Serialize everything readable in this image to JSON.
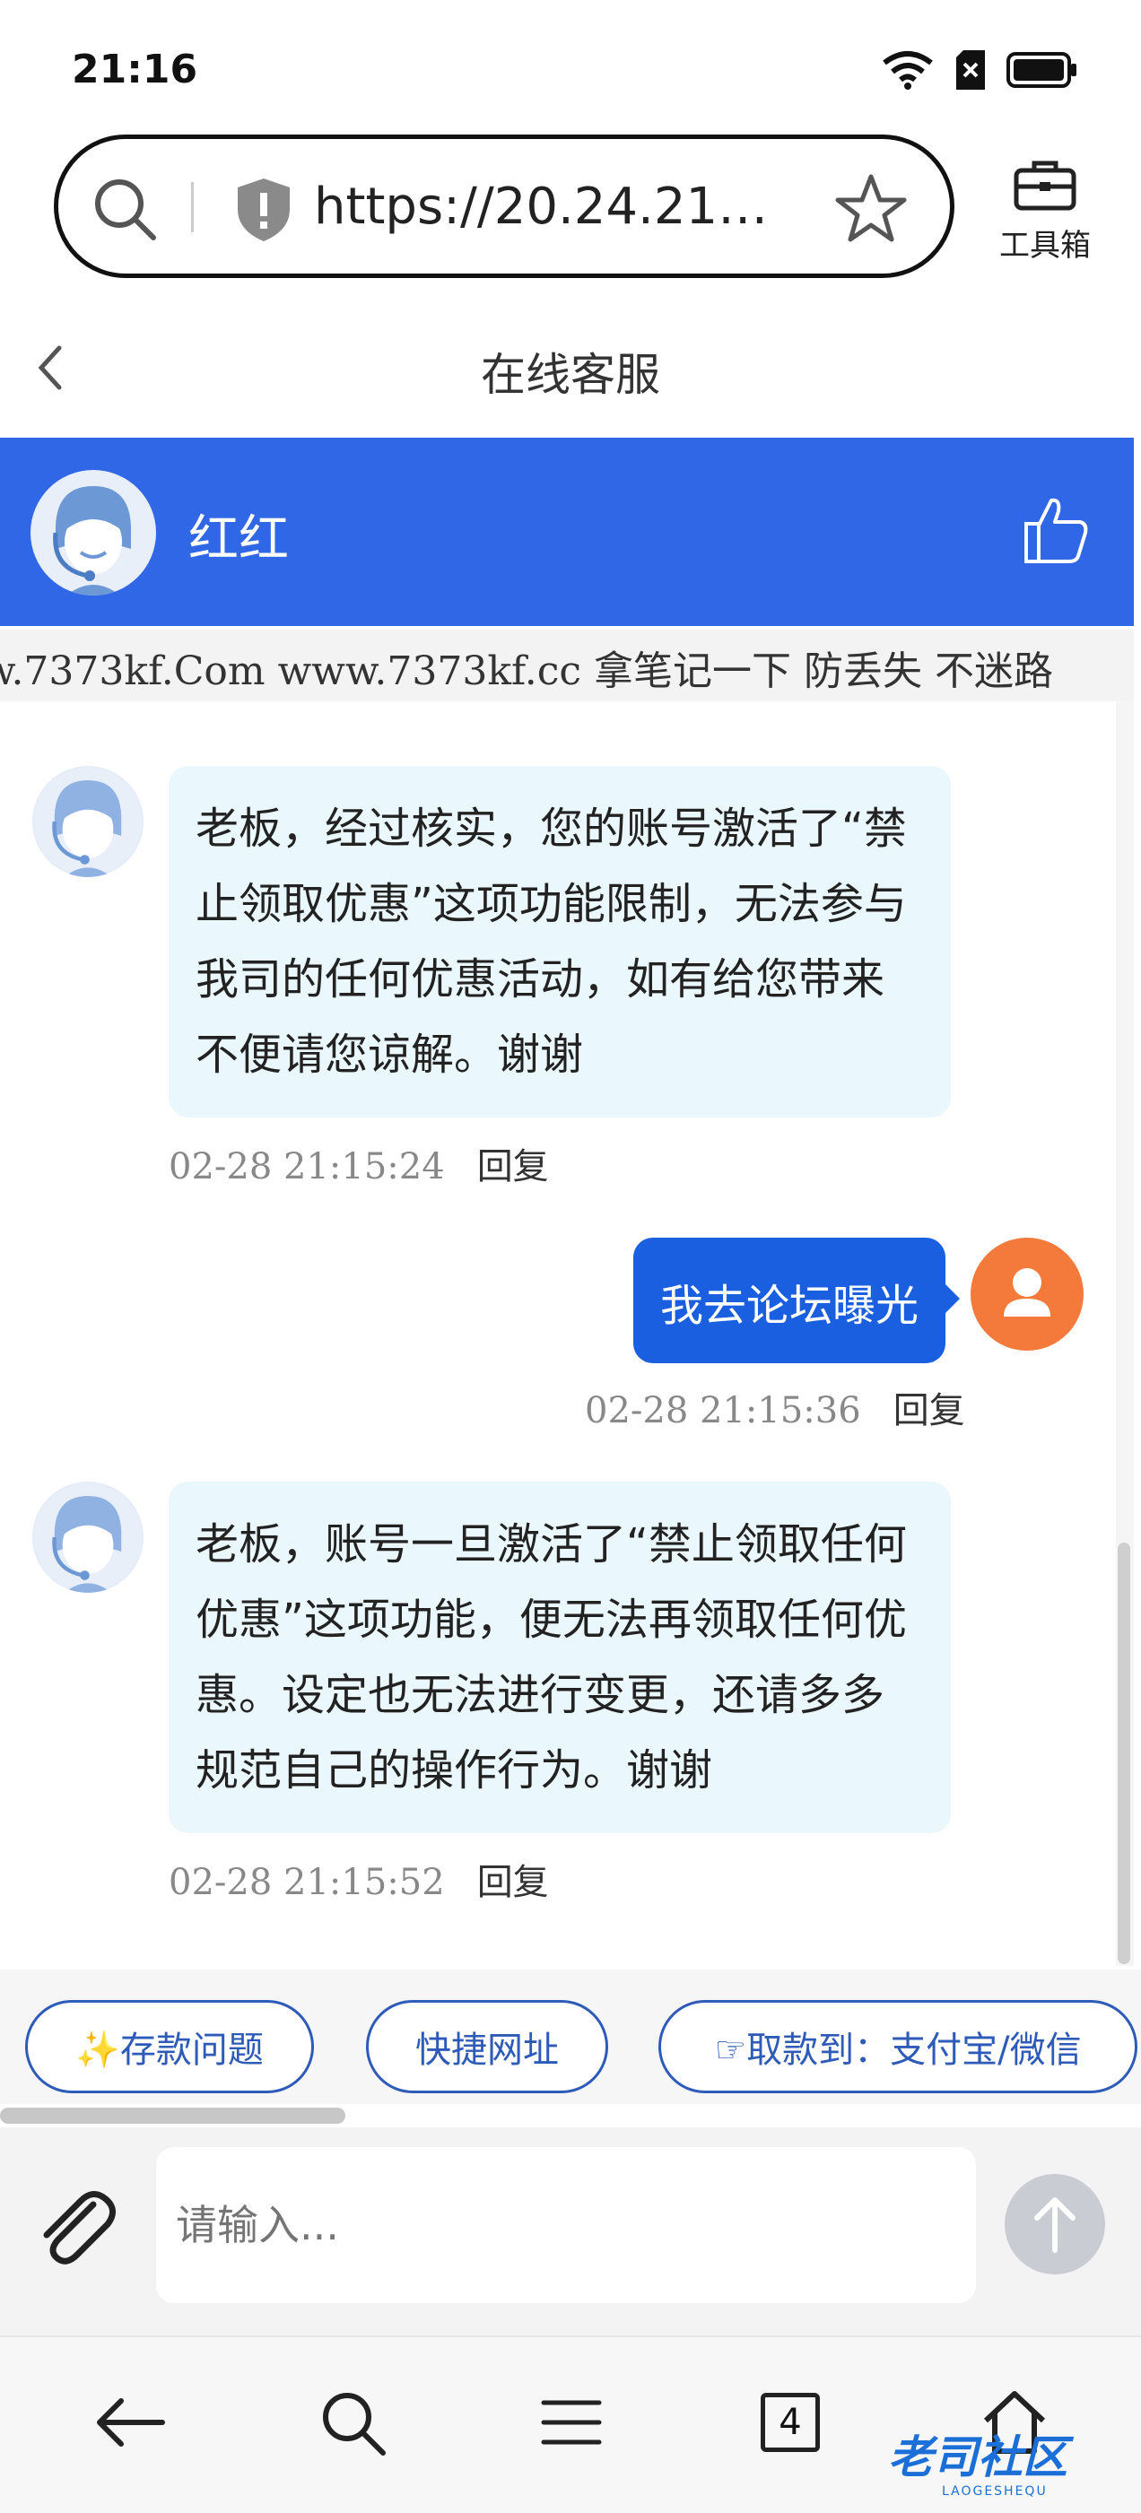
{
  "status_bar": {
    "time": "21:16"
  },
  "browser": {
    "url": "https://20.24.216.15...",
    "toolbox_label": "工具箱",
    "tab_count": "4"
  },
  "page": {
    "title": "在线客服"
  },
  "agent": {
    "name": "红红"
  },
  "marquee": {
    "text": "w.7373kf.Com www.7373kf.cc 拿笔记一下 防丢失 不迷路"
  },
  "messages": [
    {
      "from": "agent",
      "text": "老板，经过核实，您的账号激活了“禁止领取优惠”这项功能限制，无法参与我司的任何优惠活动，如有给您带来不便请您谅解。谢谢",
      "time": "02-28 21:15:24",
      "reply": "回复"
    },
    {
      "from": "user",
      "text": "我去论坛曝光",
      "time": "02-28 21:15:36",
      "reply": "回复"
    },
    {
      "from": "agent",
      "text": "老板，账号一旦激活了“禁止领取任何优惠”这项功能，便无法再领取任何优惠。设定也无法进行变更，还请多多规范自己的操作行为。谢谢",
      "time": "02-28 21:15:52",
      "reply": "回复"
    }
  ],
  "quick_chips": [
    "✨存款问题",
    "快捷网址",
    "☞取款到：支付宝/微信"
  ],
  "composer": {
    "placeholder": "请输入..."
  },
  "watermark": {
    "text": "老司社区",
    "sub": "LAOGESHEQU"
  },
  "colors": {
    "brand_blue": "#3067e6",
    "user_bubble": "#1a5fe0",
    "agent_bubble": "#eaf7fc",
    "user_avatar": "#f47a3c"
  }
}
